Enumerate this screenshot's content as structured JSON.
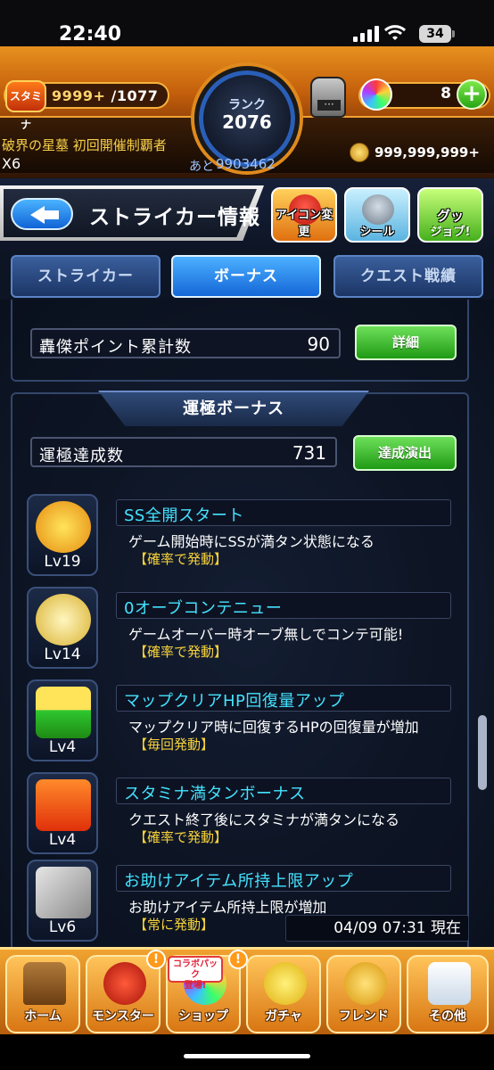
{
  "status_bar": {
    "time": "22:40",
    "battery": "34"
  },
  "header": {
    "stamina_label": "スタミナ",
    "stamina_current": "9999+",
    "stamina_max": "/1077",
    "rank_label": "ランク",
    "rank_value": "2076",
    "rank_next_label": "あと",
    "rank_next_value": "9903462",
    "orb_count": "8",
    "title_text": "破界の星墓 初回開催制覇者",
    "title_multiplier": "X6",
    "gold": "999,999,999+"
  },
  "titlebar": {
    "title": "ストライカー情報",
    "icon_change_label": "アイコン変更",
    "seal_label": "シール",
    "goods_label": "グッ",
    "goods_label2": "ジョブ!"
  },
  "tabs": [
    {
      "label": "ストライカー",
      "active": false
    },
    {
      "label": "ボーナス",
      "active": true
    },
    {
      "label": "クエスト戦績",
      "active": false
    }
  ],
  "points": {
    "label": "轟傑ポイント累計数",
    "value": "90",
    "button": "詳細"
  },
  "luck_bonus": {
    "section_title": "運極ボーナス",
    "count_label": "運極達成数",
    "count_value": "731",
    "count_button": "達成演出",
    "items": [
      {
        "level": "Lv19",
        "name": "SS全開スタート",
        "description": "ゲーム開始時にSSが満タン状態になる",
        "trigger": "【確率で発動】",
        "icon": "go-icon"
      },
      {
        "level": "Lv14",
        "name": "0オーブコンテニュー",
        "description": "ゲームオーバー時オーブ無しでコンテ可能!",
        "trigger": "【確率で発動】",
        "icon": "wing-arrow-icon"
      },
      {
        "level": "Lv4",
        "name": "マップクリアHP回復量アップ",
        "description": "マップクリア時に回復するHPの回復量が増加",
        "trigger": "【毎回発動】",
        "icon": "hp-battery-icon"
      },
      {
        "level": "Lv4",
        "name": "スタミナ満タンボーナス",
        "description": "クエスト終了後にスタミナが満タンになる",
        "trigger": "【確率で発動】",
        "icon": "stamina-icon"
      },
      {
        "level": "Lv6",
        "name": "お助けアイテム所持上限アップ",
        "description": "お助けアイテム所持上限が増加",
        "trigger": "【常に発動】",
        "icon": "item-plus-icon"
      }
    ],
    "info_button": "i"
  },
  "timestamp": {
    "date": "04/09 07:31",
    "suffix": "現在"
  },
  "bottom_nav": {
    "collab_tag_line1": "コラボパック",
    "collab_tag_line2": "登場!",
    "badge": "!",
    "items": [
      {
        "label": "ホーム"
      },
      {
        "label": "モンスター"
      },
      {
        "label": "ショップ"
      },
      {
        "label": "ガチャ"
      },
      {
        "label": "フレンド"
      },
      {
        "label": "その他"
      }
    ]
  },
  "colors": {
    "accent_cyan": "#44e3ff",
    "trigger_yellow": "#f5d23c",
    "header_orange": "#e7901e",
    "button_green": "#1f9a14"
  }
}
